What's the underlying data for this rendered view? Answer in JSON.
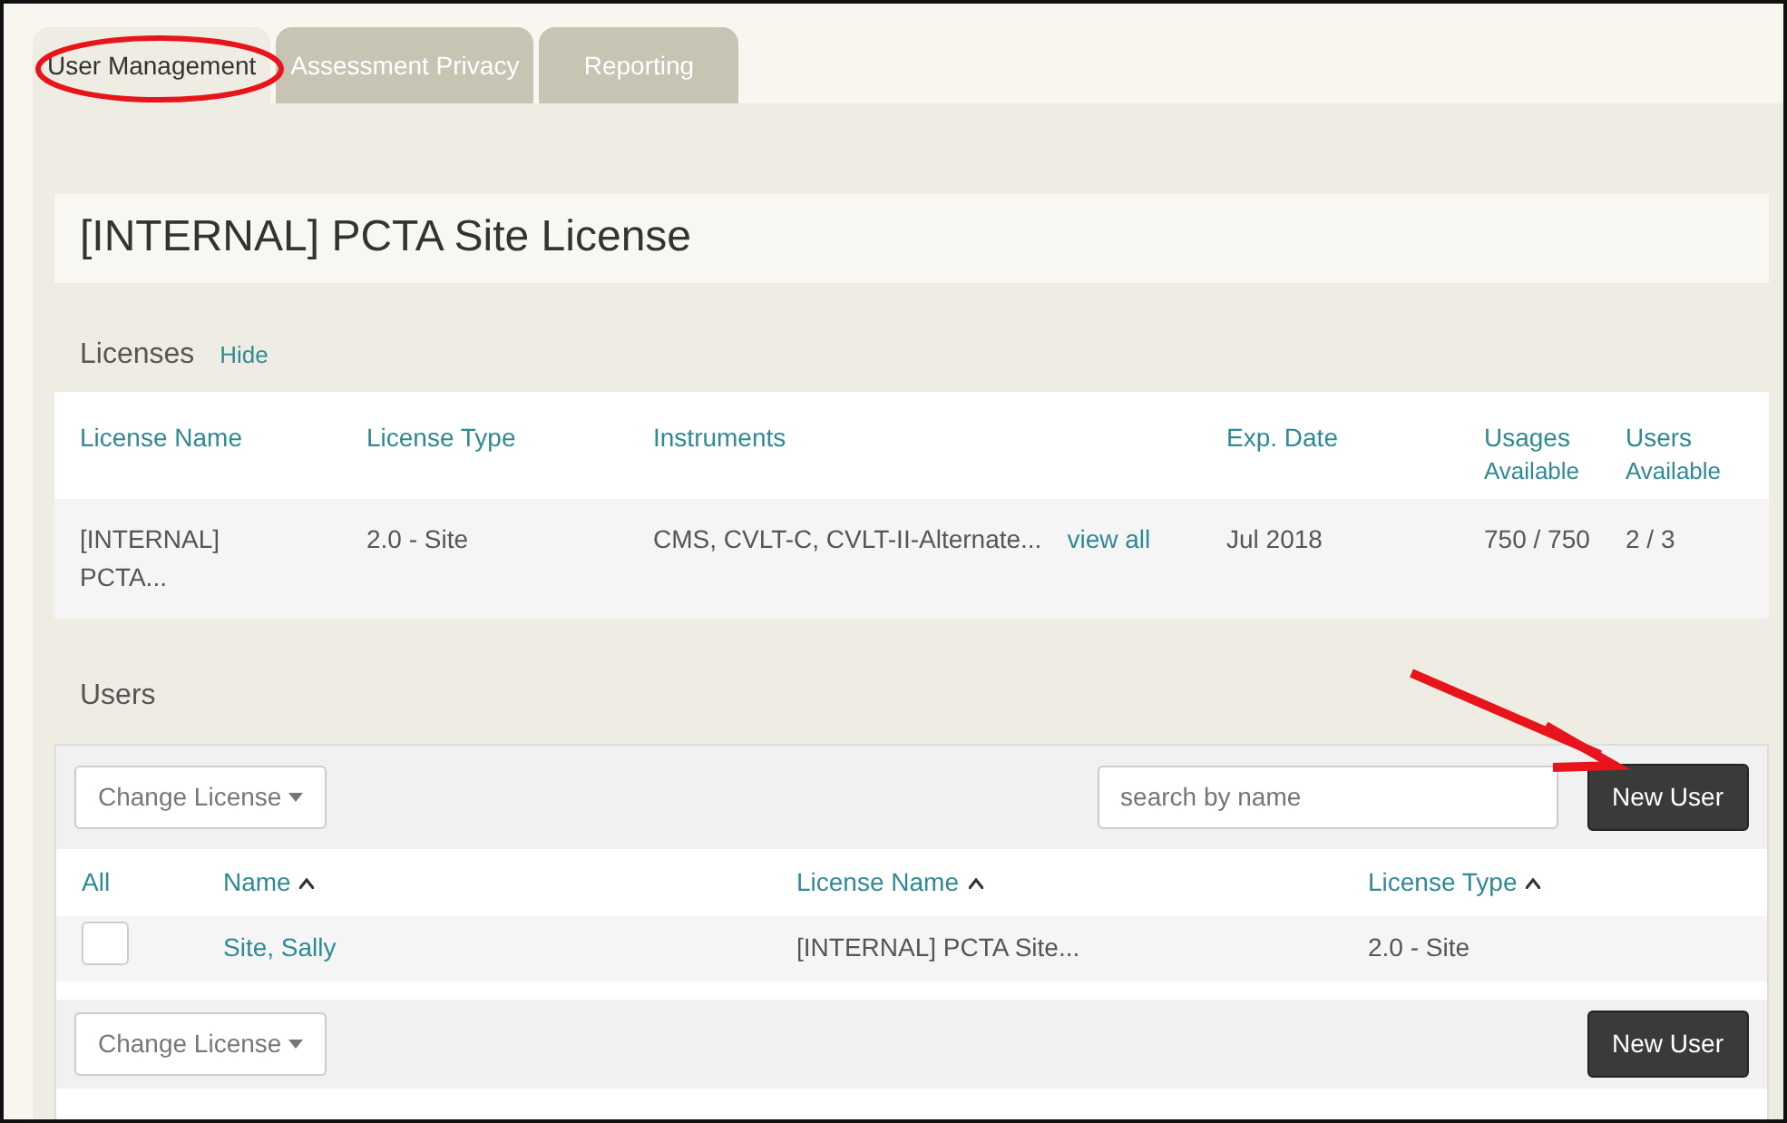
{
  "tabs": [
    {
      "label": "User Management",
      "selected": true
    },
    {
      "label": "Assessment Privacy",
      "selected": false
    },
    {
      "label": "Reporting",
      "selected": false
    }
  ],
  "title": "[INTERNAL] PCTA Site License",
  "licenses": {
    "heading": "Licenses",
    "toggle": "Hide",
    "columns": [
      {
        "label": "License Name"
      },
      {
        "label": "License Type"
      },
      {
        "label": "Instruments"
      },
      {
        "label": "Exp. Date"
      },
      {
        "label": "Usages",
        "sub": "Available"
      },
      {
        "label": "Users",
        "sub": "Available"
      }
    ],
    "rows": [
      {
        "name": "[INTERNAL] PCTA...",
        "type": "2.0 - Site",
        "instruments": "CMS, CVLT-C, CVLT-II-Alternate...",
        "view_all": "view all",
        "exp_date": "Jul 2018",
        "usages": "750 / 750",
        "users": "2 / 3"
      }
    ]
  },
  "users": {
    "heading": "Users",
    "toolbar": {
      "dropdown": "Change License",
      "search_placeholder": "search by name",
      "button": "New User"
    },
    "columns": [
      {
        "label": "All",
        "sortable": false
      },
      {
        "label": "Name",
        "sortable": true
      },
      {
        "label": "License Name",
        "sortable": true
      },
      {
        "label": "License Type",
        "sortable": true
      }
    ],
    "rows": [
      {
        "checked": false,
        "name": "Site, Sally",
        "license_name": "[INTERNAL] PCTA Site...",
        "license_type": "2.0 - Site"
      }
    ],
    "bottom_toolbar": {
      "dropdown": "Change License",
      "button": "New User"
    }
  },
  "callouts": [
    {
      "kind": "ellipse",
      "color": "#e8141b"
    },
    {
      "kind": "arrow",
      "color": "#e8141b"
    }
  ]
}
